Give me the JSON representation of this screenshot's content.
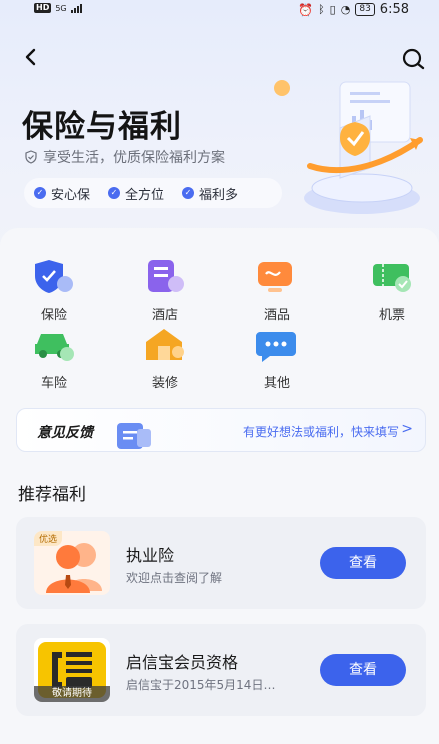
{
  "status_bar": {
    "network": "HD",
    "signal_text": "5G",
    "battery": "83",
    "time": "6:58"
  },
  "header": {
    "back_icon": "chevron-left-icon",
    "search_icon": "search-icon",
    "title": "保险与福利",
    "subtitle": "享受生活，优质保险福利方案",
    "tags": [
      "安心保",
      "全方位",
      "福利多"
    ]
  },
  "categories": [
    {
      "label": "保险",
      "icon": "shield-icon",
      "color": "#3c63ec"
    },
    {
      "label": "酒店",
      "icon": "hotel-icon",
      "color": "#8a63ec"
    },
    {
      "label": "酒品",
      "icon": "wine-icon",
      "color": "#ff8a3c"
    },
    {
      "label": "机票",
      "icon": "ticket-icon",
      "color": "#3fbf5f"
    },
    {
      "label": "车险",
      "icon": "car-icon",
      "color": "#3fbf5f"
    },
    {
      "label": "装修",
      "icon": "house-icon",
      "color": "#f5a623"
    },
    {
      "label": "其他",
      "icon": "more-icon",
      "color": "#3c8cec"
    }
  ],
  "feedback": {
    "title": "意见反馈",
    "link": "有更好想法或福利，快来填写",
    "arrow": ">"
  },
  "section_title": "推荐福利",
  "cards": [
    {
      "badge": "优选",
      "name": "执业险",
      "desc": "欢迎点击查阅了解",
      "button": "查看"
    },
    {
      "badge": "敬请期待",
      "name": "启信宝会员资格",
      "desc": "启信宝于2015年5月14日…",
      "button": "查看"
    }
  ]
}
